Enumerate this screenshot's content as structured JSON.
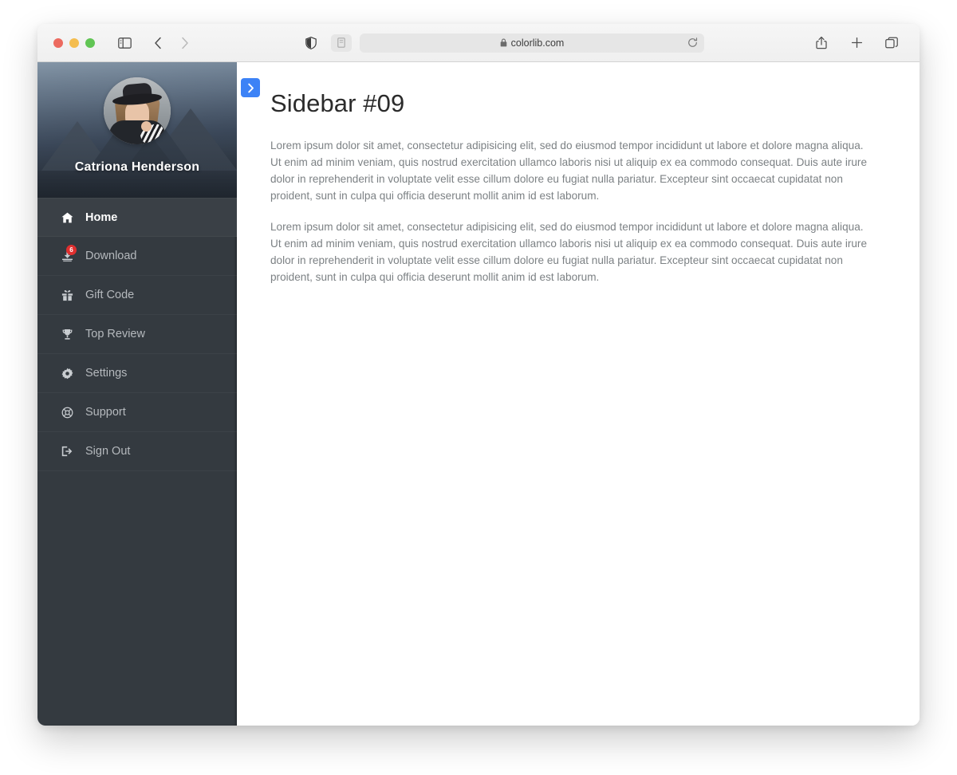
{
  "browser": {
    "url": "colorlib.com",
    "icons": {
      "sidebar_toggle": "sidebar-toggle-icon",
      "back": "back-arrow-icon",
      "forward": "forward-arrow-icon",
      "shield": "privacy-shield-icon",
      "reader": "reader-mode-icon",
      "lock": "lock-icon",
      "reload": "reload-icon",
      "share": "share-icon",
      "new_tab": "plus-icon",
      "tab_overview": "tab-overview-icon"
    }
  },
  "sidebar": {
    "profile": {
      "name": "Catriona Henderson",
      "avatar_alt": "avatar"
    },
    "items": [
      {
        "label": "Home",
        "icon": "home-icon",
        "active": true,
        "badge": null
      },
      {
        "label": "Download",
        "icon": "download-icon",
        "active": false,
        "badge": "6"
      },
      {
        "label": "Gift Code",
        "icon": "gift-icon",
        "active": false,
        "badge": null
      },
      {
        "label": "Top Review",
        "icon": "trophy-icon",
        "active": false,
        "badge": null
      },
      {
        "label": "Settings",
        "icon": "gear-icon",
        "active": false,
        "badge": null
      },
      {
        "label": "Support",
        "icon": "lifering-icon",
        "active": false,
        "badge": null
      },
      {
        "label": "Sign Out",
        "icon": "sign-out-icon",
        "active": false,
        "badge": null
      }
    ]
  },
  "content": {
    "toggle_label": "",
    "title": "Sidebar #09",
    "paragraphs": [
      "Lorem ipsum dolor sit amet, consectetur adipisicing elit, sed do eiusmod tempor incididunt ut labore et dolore magna aliqua. Ut enim ad minim veniam, quis nostrud exercitation ullamco laboris nisi ut aliquip ex ea commodo consequat. Duis aute irure dolor in reprehenderit in voluptate velit esse cillum dolore eu fugiat nulla pariatur. Excepteur sint occaecat cupidatat non proident, sunt in culpa qui officia deserunt mollit anim id est laborum.",
      "Lorem ipsum dolor sit amet, consectetur adipisicing elit, sed do eiusmod tempor incididunt ut labore et dolore magna aliqua. Ut enim ad minim veniam, quis nostrud exercitation ullamco laboris nisi ut aliquip ex ea commodo consequat. Duis aute irure dolor in reprehenderit in voluptate velit esse cillum dolore eu fugiat nulla pariatur. Excepteur sint occaecat cupidatat non proident, sunt in culpa qui officia deserunt mollit anim id est laborum."
    ]
  },
  "colors": {
    "sidebar_bg": "#343a40",
    "sidebar_active_bg": "#3a4046",
    "accent_blue": "#3c82f6",
    "badge_red": "#e02f2f",
    "text_muted": "#7c8184"
  }
}
